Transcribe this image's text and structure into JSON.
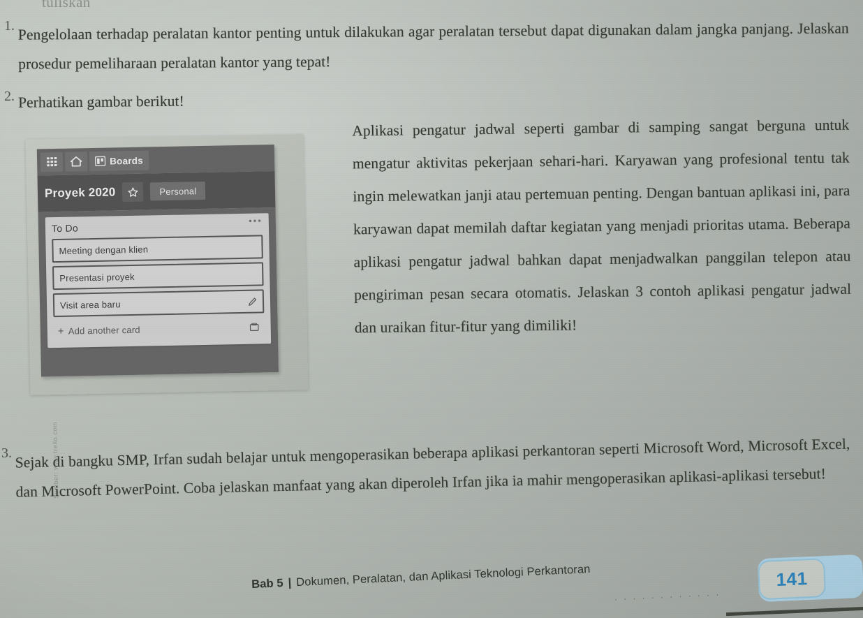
{
  "page": {
    "background_color": "#b3b9b3",
    "ghost_line_text": "tuliskan"
  },
  "questions": [
    {
      "marker": "1.",
      "text": "Pengelolaan terhadap peralatan kantor penting untuk dilakukan agar peralatan tersebut dapat digunakan dalam jangka panjang. Jelaskan prosedur pemeliharaan peralatan kantor yang tepat!"
    },
    {
      "marker": "2.",
      "text": "Perhatikan gambar berikut!"
    },
    {
      "marker": "3.",
      "text": "Sejak di bangku SMP, Irfan sudah belajar untuk mengoperasikan beberapa aplikasi perkantoran seperti Microsoft Word, Microsoft Excel, dan Microsoft PowerPoint. Coba jelaskan manfaat yang akan diperoleh Irfan jika ia mahir mengoperasikan aplikasi-aplikasi tersebut!"
    }
  ],
  "figure_paragraph": "Aplikasi pengatur jadwal seperti gambar di samping sangat berguna untuk mengatur aktivitas pekerjaan sehari-hari. Karyawan yang profesional tentu tak ingin melewatkan janji atau pertemuan penting. Dengan bantuan aplikasi ini, para karyawan dapat memilah daftar kegiatan yang menjadi prioritas utama. Beberapa aplikasi pengatur jadwal bahkan dapat menjadwalkan panggilan telepon atau pengiriman pesan secara otomatis. Jelaskan 3 contoh aplikasi pengatur jadwal dan uraikan fitur-fitur yang dimiliki!",
  "figure": {
    "watermark": "Sumber: www.trello.com",
    "app": {
      "nav": {
        "grid_icon": "grid-icon",
        "home_icon": "home-icon",
        "boards_icon": "boards-icon",
        "boards_label": "Boards"
      },
      "board_header": {
        "title": "Proyek 2020",
        "star_icon": "star-icon",
        "team_label": "Personal"
      },
      "list": {
        "title": "To Do",
        "menu_icon": "ellipsis-icon",
        "cards": [
          {
            "title": "Meeting dengan klien",
            "icon": ""
          },
          {
            "title": "Presentasi proyek",
            "icon": ""
          },
          {
            "title": "Visit area baru",
            "icon": "pencil-icon"
          }
        ],
        "add_card_label": "Add another card",
        "add_card_plus": "+",
        "template_icon": "card-template-icon"
      }
    }
  },
  "footer": {
    "chapter": "Bab 5",
    "separator": "|",
    "title": "Dokumen, Peralatan, dan Aplikasi Teknologi Perkantoran",
    "dots": ". . . . . . . . . . . .",
    "page_number": "141",
    "accent_color": "#2b7fb5"
  }
}
